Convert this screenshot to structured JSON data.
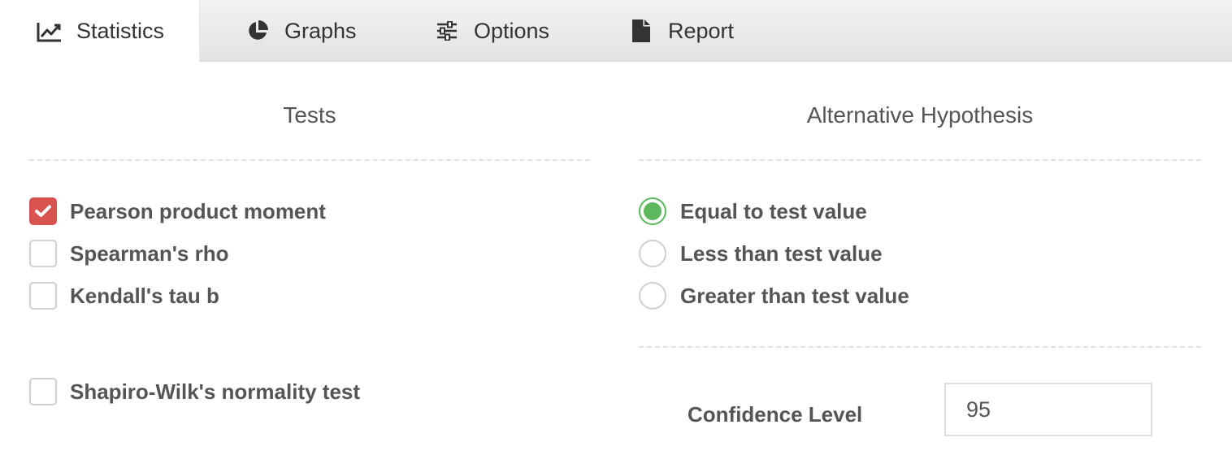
{
  "tabs": [
    {
      "label": "Statistics",
      "icon": "line-chart-icon",
      "active": true
    },
    {
      "label": "Graphs",
      "icon": "pie-chart-icon",
      "active": false
    },
    {
      "label": "Options",
      "icon": "sliders-icon",
      "active": false
    },
    {
      "label": "Report",
      "icon": "file-icon",
      "active": false
    }
  ],
  "tests": {
    "title": "Tests",
    "options": [
      {
        "label": "Pearson product moment",
        "checked": true
      },
      {
        "label": "Spearman's rho",
        "checked": false
      },
      {
        "label": "Kendall's tau b",
        "checked": false
      }
    ],
    "normality": {
      "label": "Shapiro-Wilk's normality test",
      "checked": false
    }
  },
  "hypothesis": {
    "title": "Alternative Hypothesis",
    "options": [
      {
        "label": "Equal to test value",
        "selected": true
      },
      {
        "label": "Less than test value",
        "selected": false
      },
      {
        "label": "Greater than test value",
        "selected": false
      }
    ]
  },
  "confidence": {
    "label": "Confidence Level",
    "value": "95"
  },
  "colors": {
    "checkbox_checked": "#d9534f",
    "radio_selected": "#5cb85c",
    "text": "#555555"
  }
}
